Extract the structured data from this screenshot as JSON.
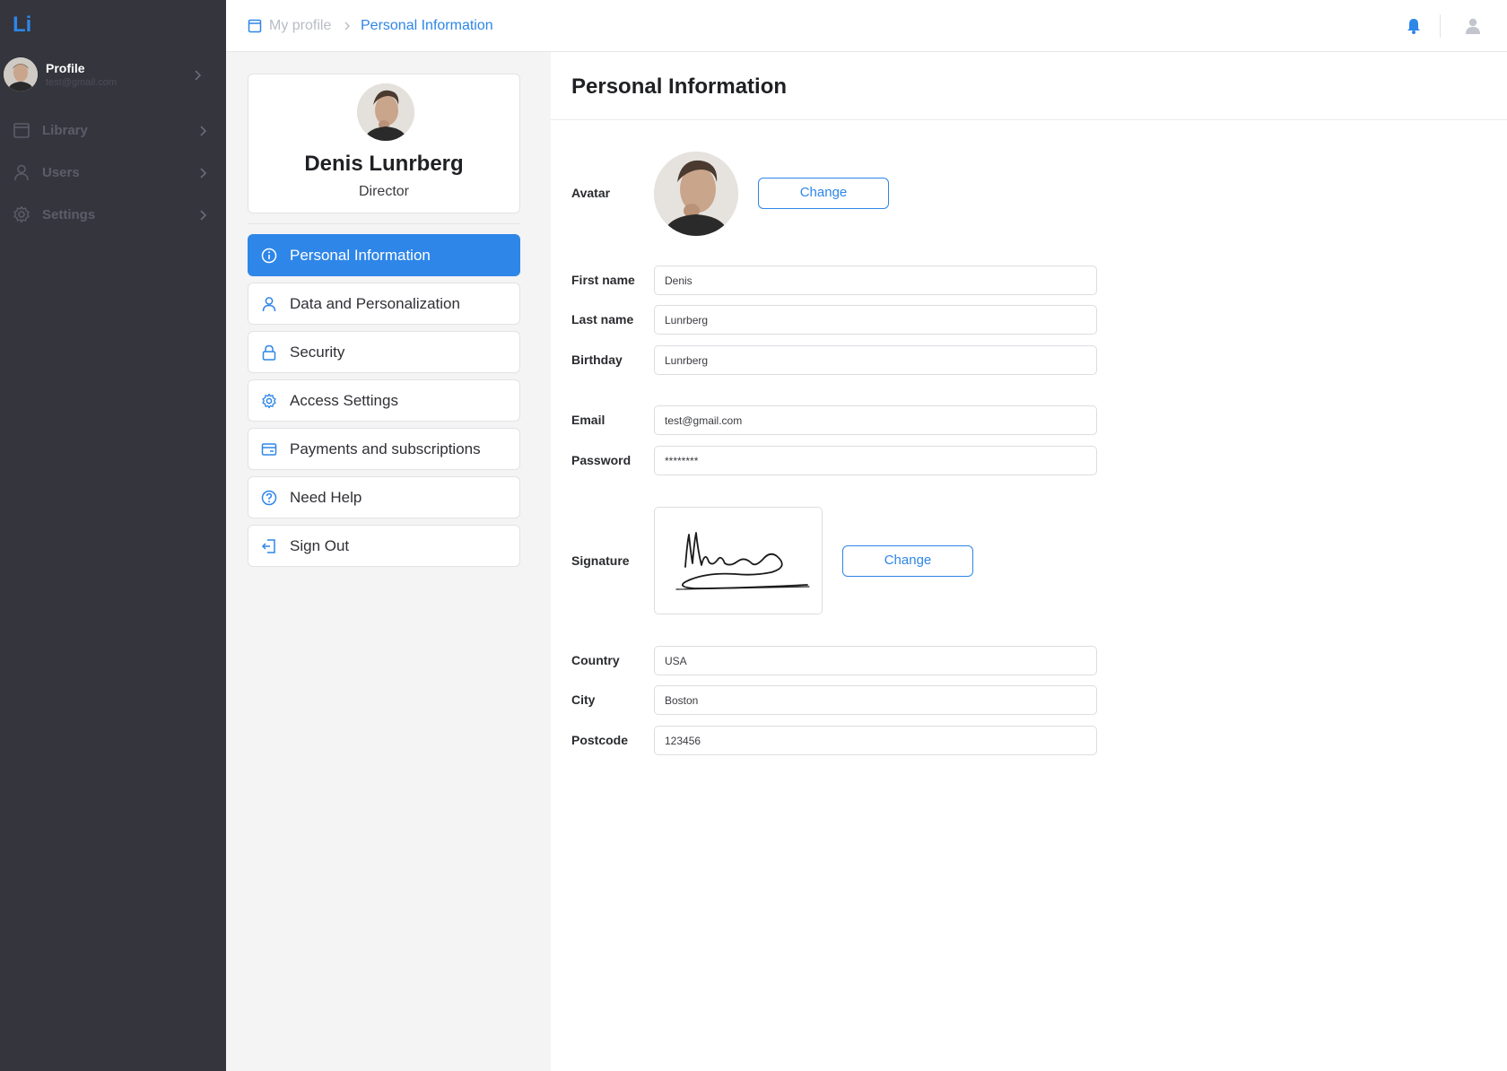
{
  "app": {
    "logo": "Li"
  },
  "sidebar": {
    "profile": {
      "name": "Profile",
      "email": "test@gmail.com"
    },
    "items": [
      {
        "label": "Library",
        "icon": "library-icon"
      },
      {
        "label": "Users",
        "icon": "user-icon"
      },
      {
        "label": "Settings",
        "icon": "gear-icon"
      }
    ]
  },
  "header": {
    "breadcrumb": [
      "My profile",
      "Personal Information"
    ],
    "icons": [
      "bell-icon",
      "user-icon"
    ]
  },
  "profile_card": {
    "name": "Denis Lunrberg",
    "role": "Director"
  },
  "menu": [
    {
      "label": "Personal Information",
      "icon": "info-icon",
      "active": true
    },
    {
      "label": "Data and Personalization",
      "icon": "user-icon",
      "active": false
    },
    {
      "label": "Security",
      "icon": "lock-icon",
      "active": false
    },
    {
      "label": "Access Settings",
      "icon": "gear-icon",
      "active": false
    },
    {
      "label": "Payments and subscriptions",
      "icon": "wallet-icon",
      "active": false
    },
    {
      "label": "Need Help",
      "icon": "help-icon",
      "active": false
    },
    {
      "label": "Sign Out",
      "icon": "sign-out-icon",
      "active": false
    }
  ],
  "main": {
    "title": "Personal Information",
    "avatar": {
      "label": "Avatar",
      "button": "Change"
    },
    "fields": {
      "first_name": {
        "label": "First name",
        "value": "Denis"
      },
      "last_name": {
        "label": "Last name",
        "value": "Lunrberg"
      },
      "birthday": {
        "label": "Birthday",
        "value": "Lunrberg"
      },
      "email": {
        "label": "Email",
        "value": "test@gmail.com"
      },
      "password": {
        "label": "Password",
        "value": "********"
      },
      "country": {
        "label": "Country",
        "value": "USA"
      },
      "city": {
        "label": "City",
        "value": "Boston"
      },
      "postcode": {
        "label": "Postcode",
        "value": "123456"
      }
    },
    "signature": {
      "label": "Signature",
      "button": "Change"
    }
  },
  "colors": {
    "accent": "#2e86e8",
    "sidebar_bg": "#34353d",
    "panel_bg": "#f4f4f5"
  }
}
